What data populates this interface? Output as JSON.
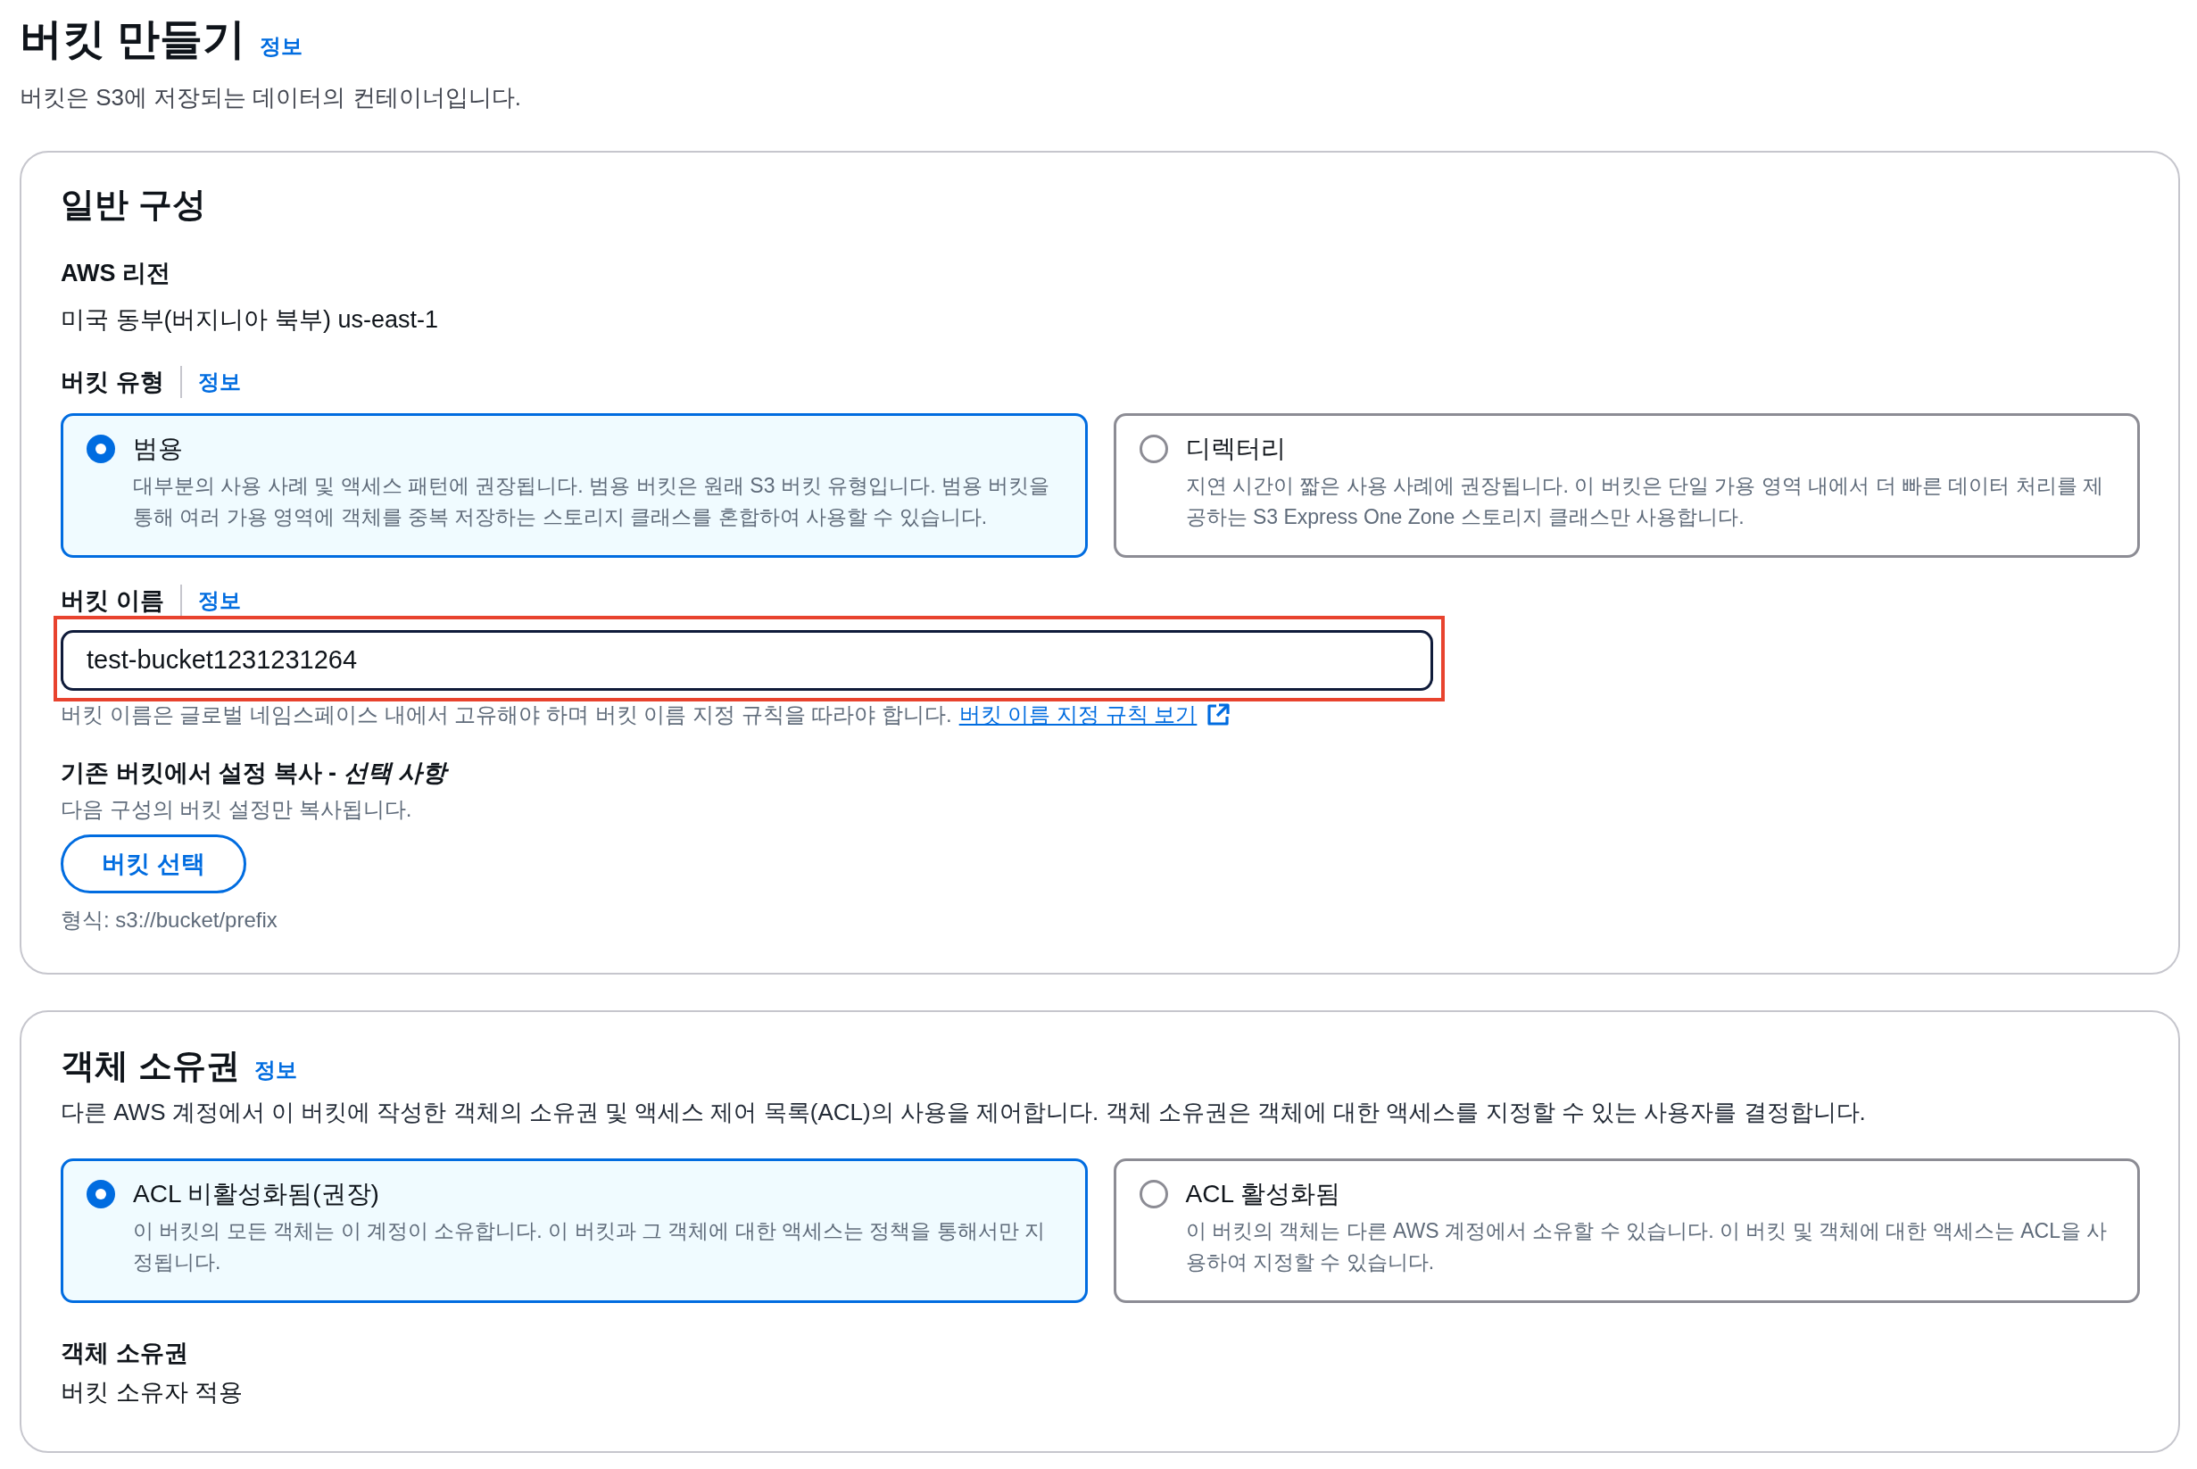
{
  "header": {
    "title": "버킷 만들기",
    "info_link": "정보",
    "description": "버킷은 S3에 저장되는 데이터의 컨테이너입니다."
  },
  "general_configuration": {
    "title": "일반 구성",
    "aws_region": {
      "label": "AWS 리전",
      "value": "미국 동부(버지니아 북부) us-east-1"
    },
    "bucket_type": {
      "label": "버킷 유형",
      "info_link": "정보",
      "options": [
        {
          "label": "범용",
          "description": "대부분의 사용 사례 및 액세스 패턴에 권장됩니다. 범용 버킷은 원래 S3 버킷 유형입니다. 범용 버킷을 통해 여러 가용 영역에 객체를 중복 저장하는 스토리지 클래스를 혼합하여 사용할 수 있습니다.",
          "selected": true
        },
        {
          "label": "디렉터리",
          "description": "지연 시간이 짧은 사용 사례에 권장됩니다. 이 버킷은 단일 가용 영역 내에서 더 빠른 데이터 처리를 제공하는 S3 Express One Zone 스토리지 클래스만 사용합니다.",
          "selected": false
        }
      ]
    },
    "bucket_name": {
      "label": "버킷 이름",
      "info_link": "정보",
      "value": "test-bucket1231231264",
      "highlighted": true,
      "hint": "버킷 이름은 글로벌 네임스페이스 내에서 고유해야 하며 버킷 이름 지정 규칙을 따라야 합니다.",
      "hint_link": "버킷 이름 지정 규칙 보기"
    },
    "copy_settings": {
      "label": "기존 버킷에서 설정 복사 - *선택 사항*",
      "description": "다음 구성의 버킷 설정만 복사됩니다.",
      "button": "버킷 선택",
      "format_hint": "형식: s3://bucket/prefix"
    }
  },
  "object_ownership": {
    "title": "객체 소유권",
    "info_link": "정보",
    "description": "다른 AWS 계정에서 이 버킷에 작성한 객체의 소유권 및 액세스 제어 목록(ACL)의 사용을 제어합니다. 객체 소유권은 객체에 대한 액세스를 지정할 수 있는 사용자를 결정합니다.",
    "options": [
      {
        "label": "ACL 비활성화됨(권장)",
        "description": "이 버킷의 모든 객체는 이 계정이 소유합니다. 이 버킷과 그 객체에 대한 액세스는 정책을 통해서만 지정됩니다.",
        "selected": true
      },
      {
        "label": "ACL 활성화됨",
        "description": "이 버킷의 객체는 다른 AWS 계정에서 소유할 수 있습니다. 이 버킷 및 객체에 대한 액세스는 ACL을 사용하여 지정할 수 있습니다.",
        "selected": false
      }
    ],
    "ownership": {
      "label": "객체 소유권",
      "value": "버킷 소유자 적용"
    }
  }
}
